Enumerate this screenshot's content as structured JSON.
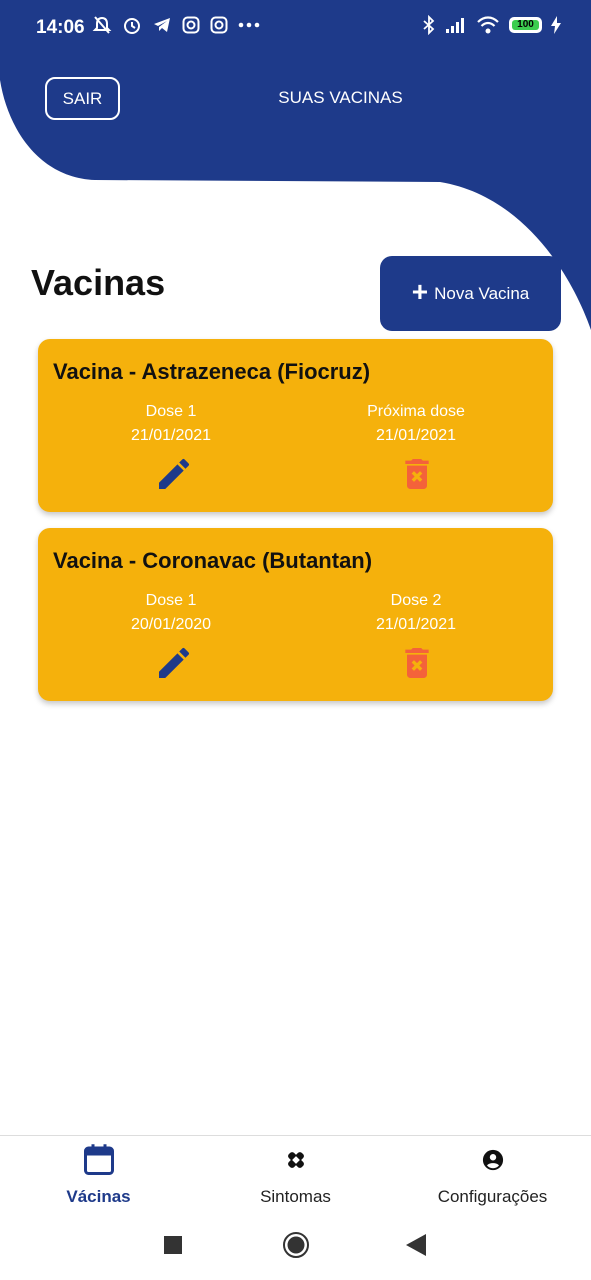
{
  "colors": {
    "primary": "#1e3a8a",
    "card": "#f5b10c",
    "delete": "#f4623a"
  },
  "status_bar": {
    "time": "14:06",
    "battery": "100"
  },
  "header": {
    "logout_label": "SAIR",
    "title": "SUAS VACINAS"
  },
  "section": {
    "title": "Vacinas",
    "new_button_label": "Nova Vacina"
  },
  "vaccines": [
    {
      "name": "Vacina - Astrazeneca (Fiocruz)",
      "left_label": "Dose 1",
      "left_date": "21/01/2021",
      "right_label": "Próxima dose",
      "right_date": "21/01/2021"
    },
    {
      "name": "Vacina - Coronavac (Butantan)",
      "left_label": "Dose 1",
      "left_date": "20/01/2020",
      "right_label": "Dose 2",
      "right_date": "21/01/2021"
    }
  ],
  "bottom_nav": [
    {
      "label": "Vácinas",
      "icon": "calendar-icon",
      "active": true
    },
    {
      "label": "Sintomas",
      "icon": "bandage-icon",
      "active": false
    },
    {
      "label": "Configurações",
      "icon": "account-circle-icon",
      "active": false
    }
  ],
  "system_nav": [
    "recent-apps-icon",
    "home-icon",
    "back-icon"
  ]
}
